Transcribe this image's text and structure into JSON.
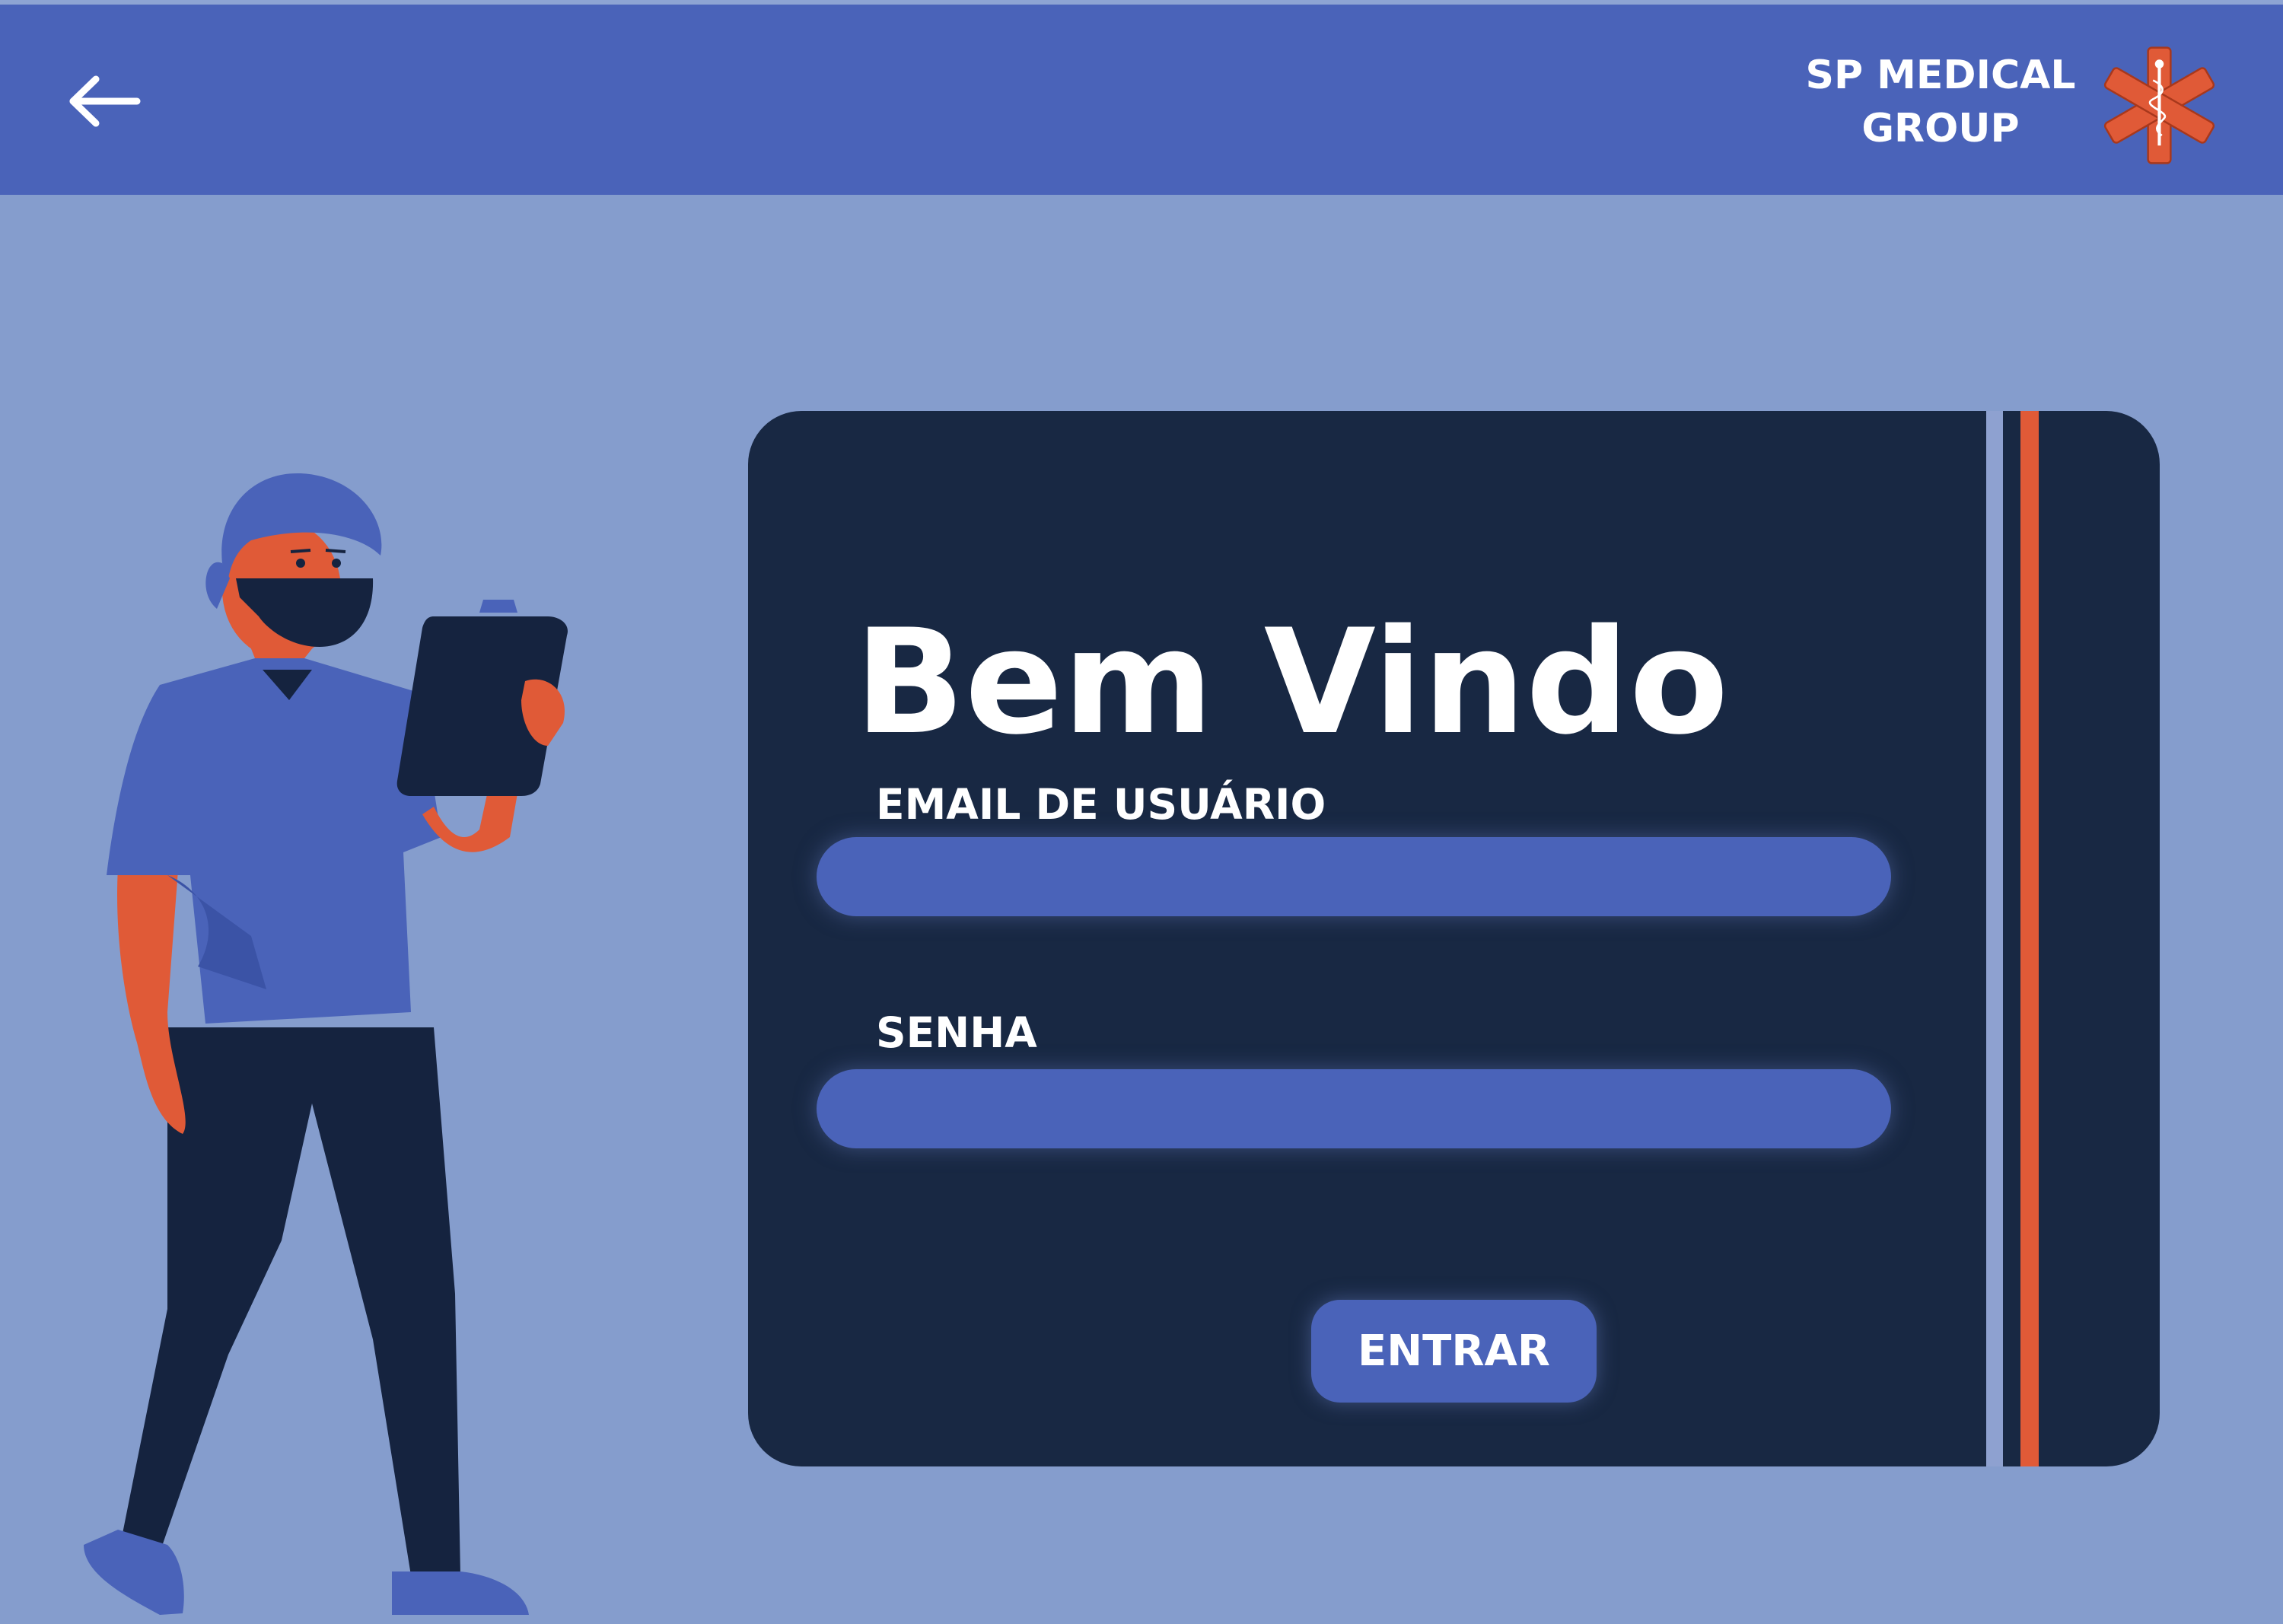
{
  "header": {
    "back_icon": "arrow-left-icon",
    "brand_line1": "SP MEDICAL",
    "brand_line2": "GROUP",
    "logo_icon": "star-of-life-icon"
  },
  "login": {
    "title": "Bem Vindo",
    "email_label": "EMAIL DE USUÁRIO",
    "email_value": "",
    "password_label": "SENHA",
    "password_value": "",
    "submit_label": "ENTRAR"
  },
  "colors": {
    "header": "#4a63b9",
    "background": "#859dcd",
    "card": "#182843",
    "accent": "#e05a37",
    "input": "#4a63b9"
  }
}
